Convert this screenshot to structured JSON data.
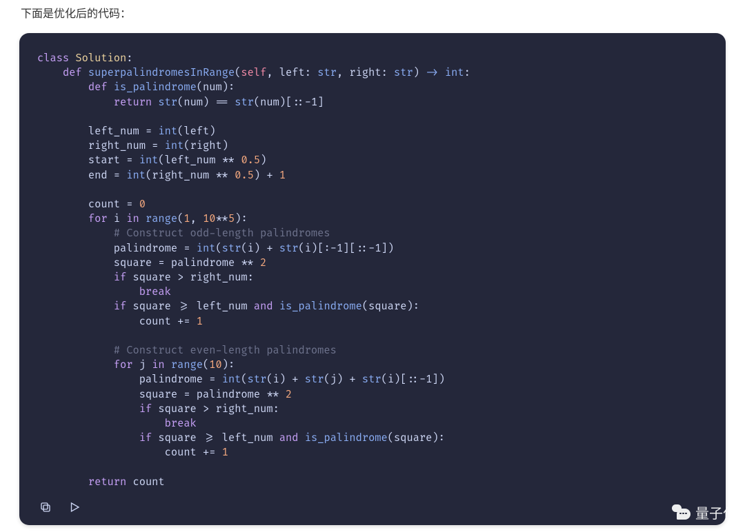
{
  "intro_text": "下面是优化后的代码：",
  "watermark": {
    "label": "量子位"
  },
  "code": {
    "class_kw": "class",
    "class_name": "Solution",
    "def_kw": "def",
    "fn_super": "superpalindromesInRange",
    "self": "self",
    "param_left": "left",
    "param_right": "right",
    "type_str": "str",
    "type_int": "int",
    "arrow": "->",
    "fn_ispal": "is_palindrome",
    "param_num": "num",
    "return_kw": "return",
    "builtin_str": "str",
    "builtin_int": "int",
    "builtin_range": "range",
    "eqeq": "==",
    "slice_rev": "[::-1]",
    "slice_nolast": "[:-1]",
    "var_leftnum": "left_num",
    "var_rightnum": "right_num",
    "var_start": "start",
    "var_end": "end",
    "pow_half": "0.5",
    "plus": "+",
    "one": "1",
    "var_count": "count",
    "zero": "0",
    "for_kw": "for",
    "in_kw": "in",
    "var_i": "i",
    "var_j": "j",
    "ten": "10",
    "exp5": "5",
    "two": "2",
    "cmt_odd": "# Construct odd-length palindromes",
    "cmt_even": "# Construct even-length palindromes",
    "var_palindrome": "palindrome",
    "var_square": "square",
    "if_kw": "if",
    "gt": ">",
    "break_kw": "break",
    "ge": ">=",
    "and_kw": "and",
    "pluseq": "+="
  }
}
